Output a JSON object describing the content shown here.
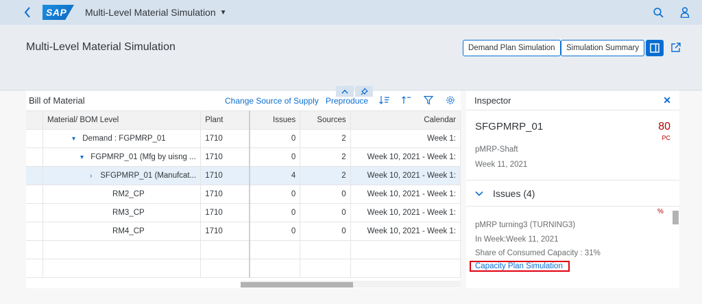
{
  "shell": {
    "app_title": "Multi-Level Material Simulation",
    "logo_text": "SAP"
  },
  "header": {
    "page_title": "Multi-Level Material Simulation",
    "demand_plan_btn": "Demand Plan Simulation",
    "simulation_summary_btn": "Simulation Summary"
  },
  "bom": {
    "title": "Bill of Material",
    "toolbar": {
      "change_source": "Change Source of Supply",
      "preproduce": "Preproduce"
    },
    "columns": {
      "material": "Material/ BOM Level",
      "plant": "Plant",
      "issues": "Issues",
      "sources": "Sources",
      "calendar": "Calendar"
    },
    "rows": [
      {
        "material": "Demand : FGPMRP_01",
        "plant": "1710",
        "issues": "0",
        "sources": "2",
        "calendar": "Week 1:"
      },
      {
        "material": "FGPMRP_01 (Mfg by uisng ...",
        "plant": "1710",
        "issues": "0",
        "sources": "2",
        "calendar": "Week 10, 2021 - Week 1:"
      },
      {
        "material": "SFGPMRP_01 (Manufcat...",
        "plant": "1710",
        "issues": "4",
        "sources": "2",
        "calendar": "Week 10, 2021 - Week 1:"
      },
      {
        "material": "RM2_CP",
        "plant": "1710",
        "issues": "0",
        "sources": "0",
        "calendar": "Week 10, 2021 - Week 1:"
      },
      {
        "material": "RM3_CP",
        "plant": "1710",
        "issues": "0",
        "sources": "0",
        "calendar": "Week 10, 2021 - Week 1:"
      },
      {
        "material": "RM4_CP",
        "plant": "1710",
        "issues": "0",
        "sources": "0",
        "calendar": "Week 10, 2021 - Week 1:"
      }
    ]
  },
  "inspector": {
    "title": "Inspector",
    "material": "SFGPMRP_01",
    "quantity": "80",
    "unit": "PC",
    "description": "pMRP-Shaft",
    "week": "Week 11, 2021",
    "issues_header": "Issues (4)",
    "percent_sign": "%",
    "issue": {
      "name": "pMRP turning3 (TURNING3)",
      "week": "In Week:Week 11, 2021",
      "share": "Share of Consumed Capacity : 31%",
      "link": "Capacity Plan Simulation"
    }
  },
  "colors": {
    "accent": "#0a6ed1",
    "critical": "#bb0000",
    "highlight_border": "#e0000f"
  }
}
